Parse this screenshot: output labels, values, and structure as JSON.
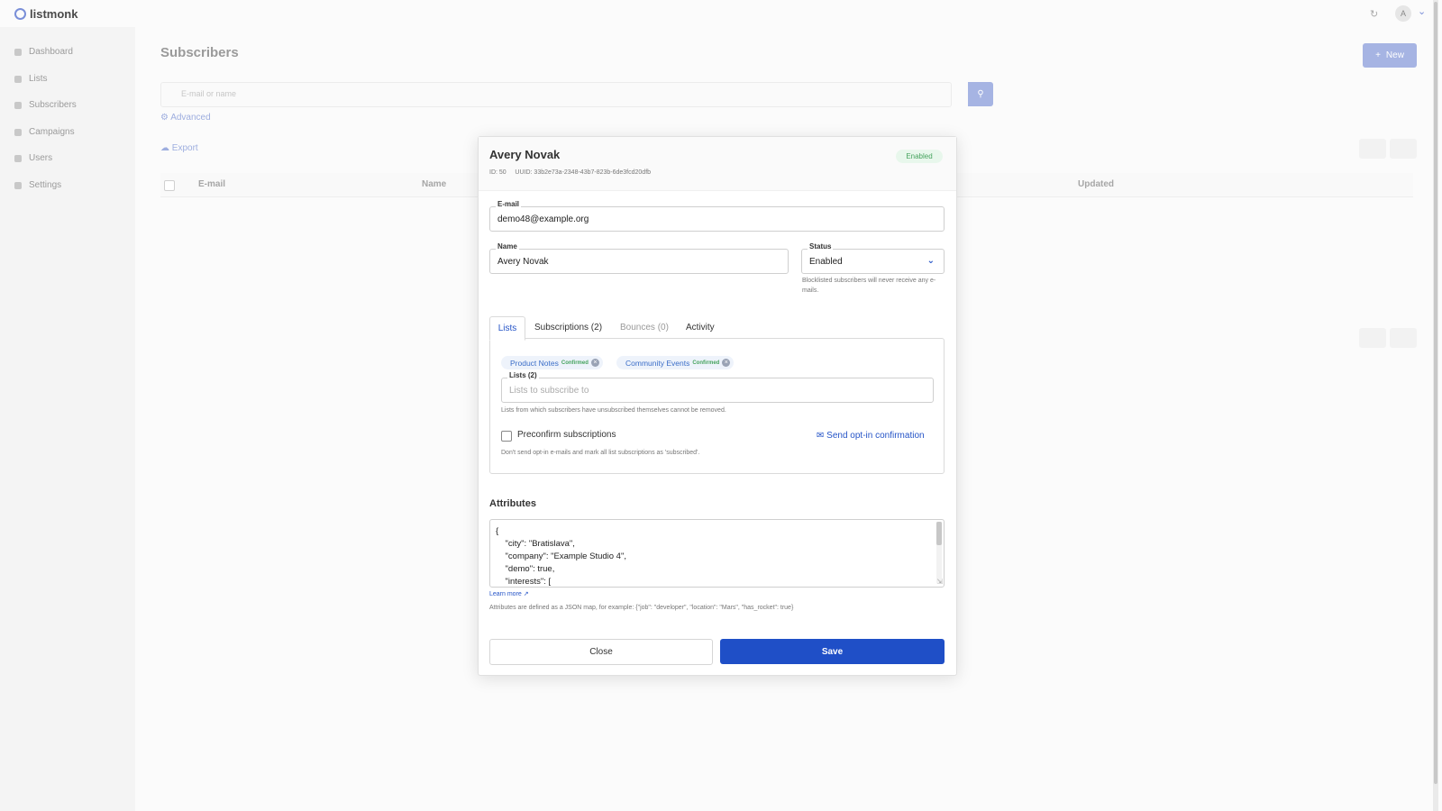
{
  "app": {
    "logo_text": "listmonk",
    "avatar_initial": "A"
  },
  "sidebar": {
    "items": [
      {
        "label": "Dashboard",
        "icon": "dashboard-icon"
      },
      {
        "label": "Lists",
        "icon": "list-icon"
      },
      {
        "label": "Subscribers",
        "icon": "users-icon"
      },
      {
        "label": "Campaigns",
        "icon": "rocket-icon"
      },
      {
        "label": "Users",
        "icon": "user-icon"
      },
      {
        "label": "Settings",
        "icon": "gear-icon"
      }
    ]
  },
  "page": {
    "title": "Subscribers",
    "new_button": "New",
    "search_placeholder": "E-mail or name",
    "advanced_link": "Advanced",
    "export_link": "Export",
    "table_columns": {
      "email": "E-mail",
      "name": "Name",
      "updated": "Updated"
    }
  },
  "modal": {
    "subscriber_name": "Avery Novak",
    "id_text": "ID: 50",
    "uuid_text": "UUID: 33b2e73a-2348-43b7-823b-6de3fcd20dfb",
    "status_tag": "Enabled",
    "email_label": "E-mail",
    "email_value": "demo48@example.org",
    "name_label": "Name",
    "name_value": "Avery Novak",
    "status_label": "Status",
    "status_value": "Enabled",
    "status_help": "Blocklisted subscribers will never receive any e-mails.",
    "tabs": {
      "lists": "Lists",
      "subscriptions": "Subscriptions (2)",
      "bounces": "Bounces (0)",
      "activity": "Activity"
    },
    "chips": [
      {
        "label": "Product Notes",
        "badge": "Confirmed"
      },
      {
        "label": "Community Events",
        "badge": "Confirmed"
      }
    ],
    "lists_label": "Lists (2)",
    "lists_placeholder": "Lists to subscribe to",
    "lists_help": "Lists from which subscribers have unsubscribed themselves cannot be removed.",
    "preconfirm_label": "Preconfirm subscriptions",
    "preconfirm_help": "Don't send opt-in e-mails and mark all list subscriptions as 'subscribed'.",
    "optin_link": "Send opt-in confirmation",
    "attributes_title": "Attributes",
    "attributes_json": "{\n    \"city\": \"Bratislava\",\n    \"company\": \"Example Studio 4\",\n    \"demo\": true,\n    \"interests\": [",
    "learn_more": "Learn more",
    "attributes_help": "Attributes are defined as a JSON map, for example: {\"job\": \"developer\", \"location\": \"Mars\", \"has_rocket\": true}",
    "close_button": "Close",
    "save_button": "Save"
  },
  "colors": {
    "primary": "#1f4fc7",
    "success": "#46a35e",
    "link": "#2554c7"
  }
}
